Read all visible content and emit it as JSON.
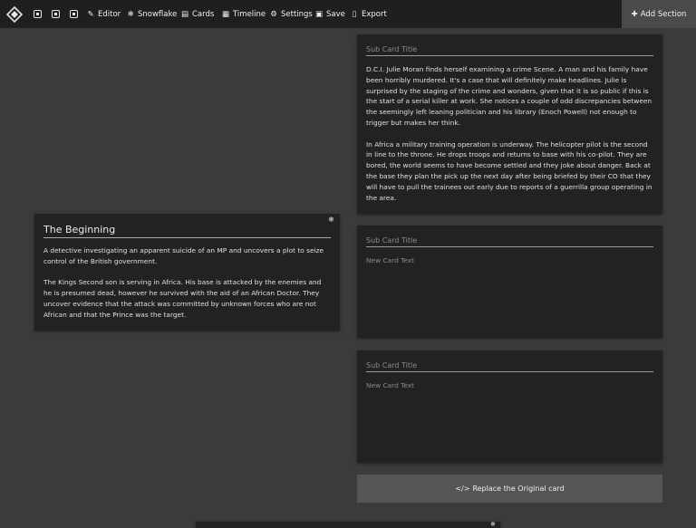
{
  "toolbar": {
    "items": [
      {
        "icon": "pencil-square-icon",
        "label": "Editor"
      },
      {
        "icon": "snowflake-icon",
        "label": "Snowflake"
      },
      {
        "icon": "id-card-icon",
        "label": "Cards"
      },
      {
        "icon": "calendar-icon",
        "label": "Timeline"
      },
      {
        "icon": "gear-icon",
        "label": "Settings"
      },
      {
        "icon": "floppy-disk-icon",
        "label": "Save"
      },
      {
        "icon": "file-export-icon",
        "label": "Export"
      }
    ],
    "add_section": "Add Section"
  },
  "main_card": {
    "title": "The Beginning",
    "paragraphs": [
      "A detective investigating an apparent suicide of an MP and  uncovers a plot to seize control of the British government.",
      "The Kings Second son is serving in Africa. His base is attacked by the enemies and he is presumed dead, however he survived with the aid of an African Doctor. They uncover evidence that the attack was  committed by unknown forces who are not African and that the Prince was the target."
    ]
  },
  "sub_cards": [
    {
      "title_placeholder": "Sub Card Title",
      "paragraphs": [
        "D.C.I. Julie Moran finds herself examining a crime Scene. A man and his family have been horribly murdered. It's a case that will definitely make headlines. Julie is surprised by the staging of the crime and wonders, given that it is so public if this is the start of a serial killer at work. She notices a couple of odd discrepancies between the seemingly left leaning politician and his library (Enoch Powell) not enough to trigger but makes her think.",
        "In Africa a military training operation is underway. The helicopter pilot is the second in line to the throne. He drops troops and returns to base with his co-pilot. They are bored, the world seems to have become settled and they joke about danger. Back at the base they plan the pick up the next day after being briefed by their CO that they will have to pull the trainees out early due to reports of a guerrilla group operating in the area."
      ]
    },
    {
      "title_placeholder": "Sub Card Title",
      "text_placeholder": "New Card Text"
    },
    {
      "title_placeholder": "Sub Card Title",
      "text_placeholder": "New Card Text"
    }
  ],
  "replace_button": "Replace the Original card"
}
